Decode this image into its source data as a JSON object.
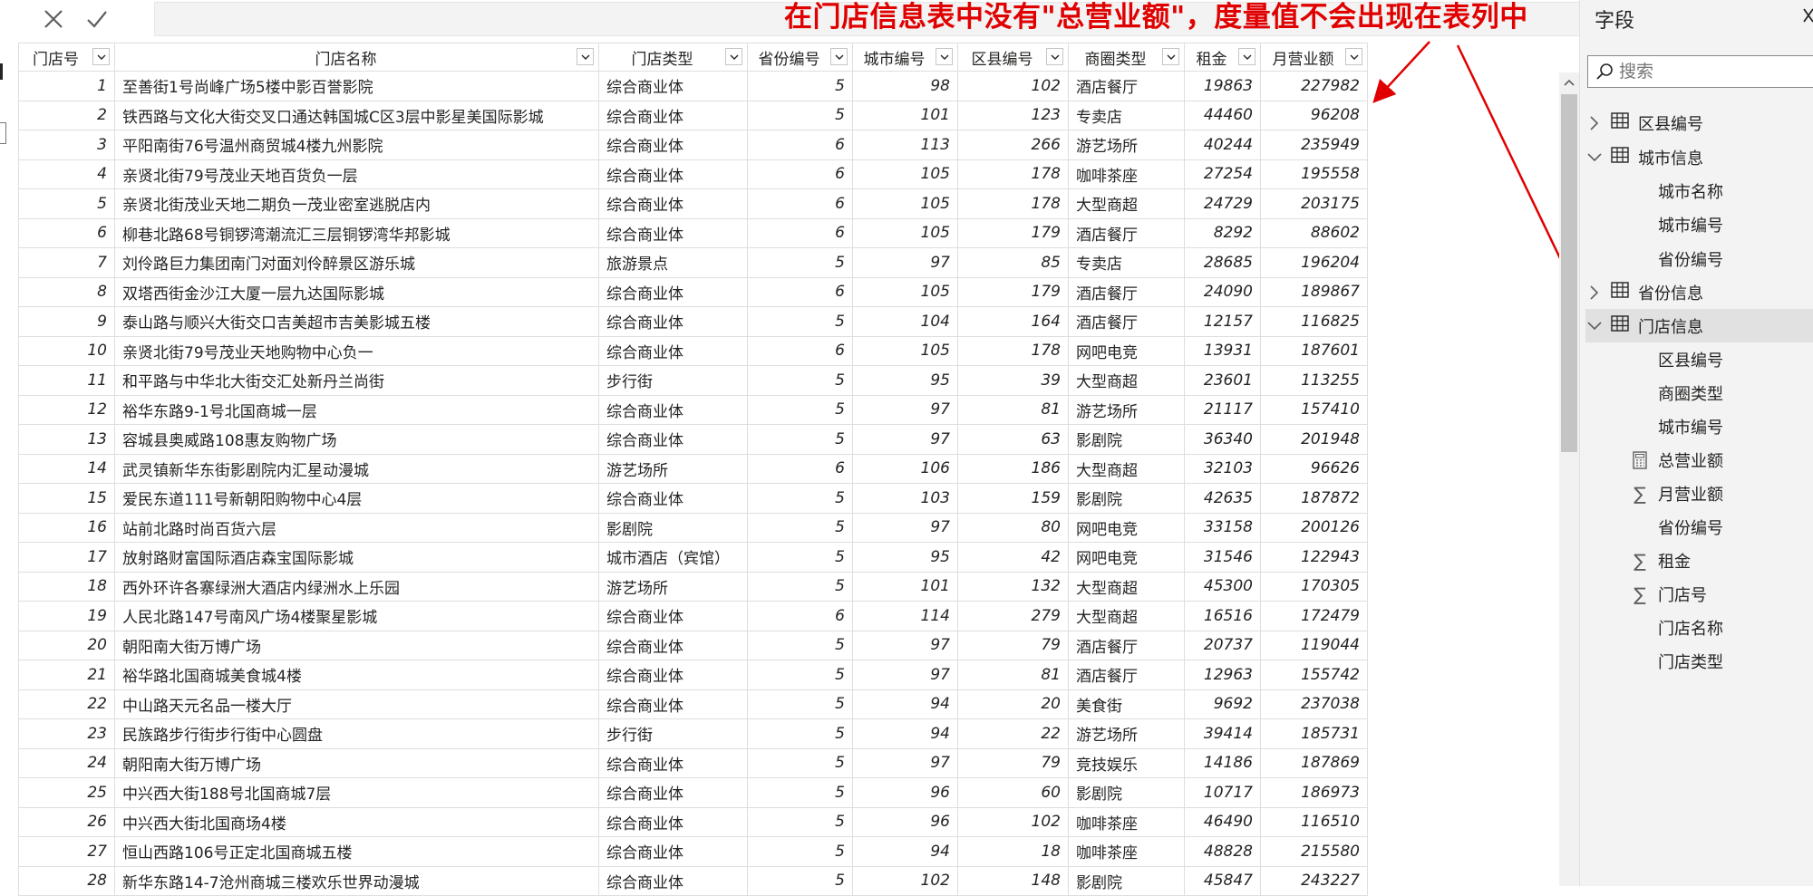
{
  "annotation": "在门店信息表中没有\"总营业额\"，度量值不会出现在表列中",
  "toolbar": {
    "cancel_icon": "close-icon",
    "commit_icon": "check-icon"
  },
  "table": {
    "columns": [
      "门店号",
      "门店名称",
      "门店类型",
      "省份编号",
      "城市编号",
      "区县编号",
      "商圈类型",
      "租金",
      "月营业额"
    ],
    "rows": [
      [
        "1",
        "至善街1号尚峰广场5楼中影百誉影院",
        "综合商业体",
        "5",
        "98",
        "102",
        "酒店餐厅",
        "19863",
        "227982"
      ],
      [
        "2",
        "铁西路与文化大街交叉口通达韩国城C区3层中影星美国际影城",
        "综合商业体",
        "5",
        "101",
        "123",
        "专卖店",
        "44460",
        "96208"
      ],
      [
        "3",
        "平阳南街76号温州商贸城4楼九州影院",
        "综合商业体",
        "6",
        "113",
        "266",
        "游艺场所",
        "40244",
        "235949"
      ],
      [
        "4",
        "亲贤北街79号茂业天地百货负一层",
        "综合商业体",
        "6",
        "105",
        "178",
        "咖啡茶座",
        "27254",
        "195558"
      ],
      [
        "5",
        "亲贤北街茂业天地二期负一茂业密室逃脱店内",
        "综合商业体",
        "6",
        "105",
        "178",
        "大型商超",
        "24729",
        "203175"
      ],
      [
        "6",
        "柳巷北路68号铜锣湾潮流汇三层铜锣湾华邦影城",
        "综合商业体",
        "6",
        "105",
        "179",
        "酒店餐厅",
        "8292",
        "88602"
      ],
      [
        "7",
        "刘伶路巨力集团南门对面刘伶醉景区游乐城",
        "旅游景点",
        "5",
        "97",
        "85",
        "专卖店",
        "28685",
        "196204"
      ],
      [
        "8",
        "双塔西街金沙江大厦一层九达国际影城",
        "综合商业体",
        "6",
        "105",
        "179",
        "酒店餐厅",
        "24090",
        "189867"
      ],
      [
        "9",
        "泰山路与顺兴大街交口吉美超市吉美影城五楼",
        "综合商业体",
        "5",
        "104",
        "164",
        "酒店餐厅",
        "12157",
        "116825"
      ],
      [
        "10",
        "亲贤北街79号茂业天地购物中心负一",
        "综合商业体",
        "6",
        "105",
        "178",
        "网吧电竞",
        "13931",
        "187601"
      ],
      [
        "11",
        "和平路与中华北大街交汇处新丹兰尚街",
        "步行街",
        "5",
        "95",
        "39",
        "大型商超",
        "23601",
        "113255"
      ],
      [
        "12",
        "裕华东路9-1号北国商城一层",
        "综合商业体",
        "5",
        "97",
        "81",
        "游艺场所",
        "21117",
        "157410"
      ],
      [
        "13",
        "容城县奥威路108惠友购物广场",
        "综合商业体",
        "5",
        "97",
        "63",
        "影剧院",
        "36340",
        "201948"
      ],
      [
        "14",
        "武灵镇新华东街影剧院内汇星动漫城",
        "游艺场所",
        "6",
        "106",
        "186",
        "大型商超",
        "32103",
        "96626"
      ],
      [
        "15",
        "爱民东道111号新朝阳购物中心4层",
        "综合商业体",
        "5",
        "103",
        "159",
        "影剧院",
        "42635",
        "187872"
      ],
      [
        "16",
        "站前北路时尚百货六层",
        "影剧院",
        "5",
        "97",
        "80",
        "网吧电竞",
        "33158",
        "200126"
      ],
      [
        "17",
        "放射路财富国际酒店森宝国际影城",
        "城市酒店（宾馆）",
        "5",
        "95",
        "42",
        "网吧电竞",
        "31546",
        "122943"
      ],
      [
        "18",
        "西外环许各寨绿洲大酒店内绿洲水上乐园",
        "游艺场所",
        "5",
        "101",
        "132",
        "大型商超",
        "45300",
        "170305"
      ],
      [
        "19",
        "人民北路147号南风广场4楼聚星影城",
        "综合商业体",
        "6",
        "114",
        "279",
        "大型商超",
        "16516",
        "172479"
      ],
      [
        "20",
        "朝阳南大街万博广场",
        "综合商业体",
        "5",
        "97",
        "79",
        "酒店餐厅",
        "20737",
        "119044"
      ],
      [
        "21",
        "裕华路北国商城美食城4楼",
        "综合商业体",
        "5",
        "97",
        "81",
        "酒店餐厅",
        "12963",
        "155742"
      ],
      [
        "22",
        "中山路天元名品一楼大厅",
        "综合商业体",
        "5",
        "94",
        "20",
        "美食街",
        "9692",
        "237038"
      ],
      [
        "23",
        "民族路步行街步行街中心圆盘",
        "步行街",
        "5",
        "94",
        "22",
        "游艺场所",
        "39414",
        "185731"
      ],
      [
        "24",
        "朝阳南大街万博广场",
        "综合商业体",
        "5",
        "97",
        "79",
        "竞技娱乐",
        "14186",
        "187869"
      ],
      [
        "25",
        "中兴西大街188号北国商城7层",
        "综合商业体",
        "5",
        "96",
        "60",
        "影剧院",
        "10717",
        "186973"
      ],
      [
        "26",
        "中兴西大街北国商场4楼",
        "综合商业体",
        "5",
        "96",
        "102",
        "咖啡茶座",
        "46490",
        "116510"
      ],
      [
        "27",
        "恒山西路106号正定北国商城五楼",
        "综合商业体",
        "5",
        "94",
        "18",
        "咖啡茶座",
        "48828",
        "215580"
      ],
      [
        "28",
        "新华东路14-7沧州商城三楼欢乐世界动漫城",
        "综合商业体",
        "5",
        "102",
        "148",
        "影剧院",
        "45847",
        "243227"
      ]
    ]
  },
  "fields_pane": {
    "title": "字段",
    "search_placeholder": "搜索",
    "items": [
      {
        "label": "区县编号",
        "kind": "table",
        "state": "collapsed"
      },
      {
        "label": "城市信息",
        "kind": "table",
        "state": "expanded"
      },
      {
        "label": "城市名称",
        "kind": "field"
      },
      {
        "label": "城市编号",
        "kind": "field"
      },
      {
        "label": "省份编号",
        "kind": "field"
      },
      {
        "label": "省份信息",
        "kind": "table",
        "state": "collapsed"
      },
      {
        "label": "门店信息",
        "kind": "table",
        "state": "expanded",
        "selected": true
      },
      {
        "label": "区县编号",
        "kind": "field"
      },
      {
        "label": "商圈类型",
        "kind": "field"
      },
      {
        "label": "城市编号",
        "kind": "field"
      },
      {
        "label": "总营业额",
        "kind": "measure",
        "icon": "calculator-icon"
      },
      {
        "label": "月营业额",
        "kind": "sum",
        "icon": "sigma-icon"
      },
      {
        "label": "省份编号",
        "kind": "field"
      },
      {
        "label": "租金",
        "kind": "sum",
        "icon": "sigma-icon"
      },
      {
        "label": "门店号",
        "kind": "sum",
        "icon": "sigma-icon"
      },
      {
        "label": "门店名称",
        "kind": "field"
      },
      {
        "label": "门店类型",
        "kind": "field"
      }
    ]
  },
  "colors": {
    "annotation": "#e00000",
    "arrow": "#e00000",
    "selected_row": "#e1e1e1",
    "pane_bg": "#f3f3f3"
  }
}
